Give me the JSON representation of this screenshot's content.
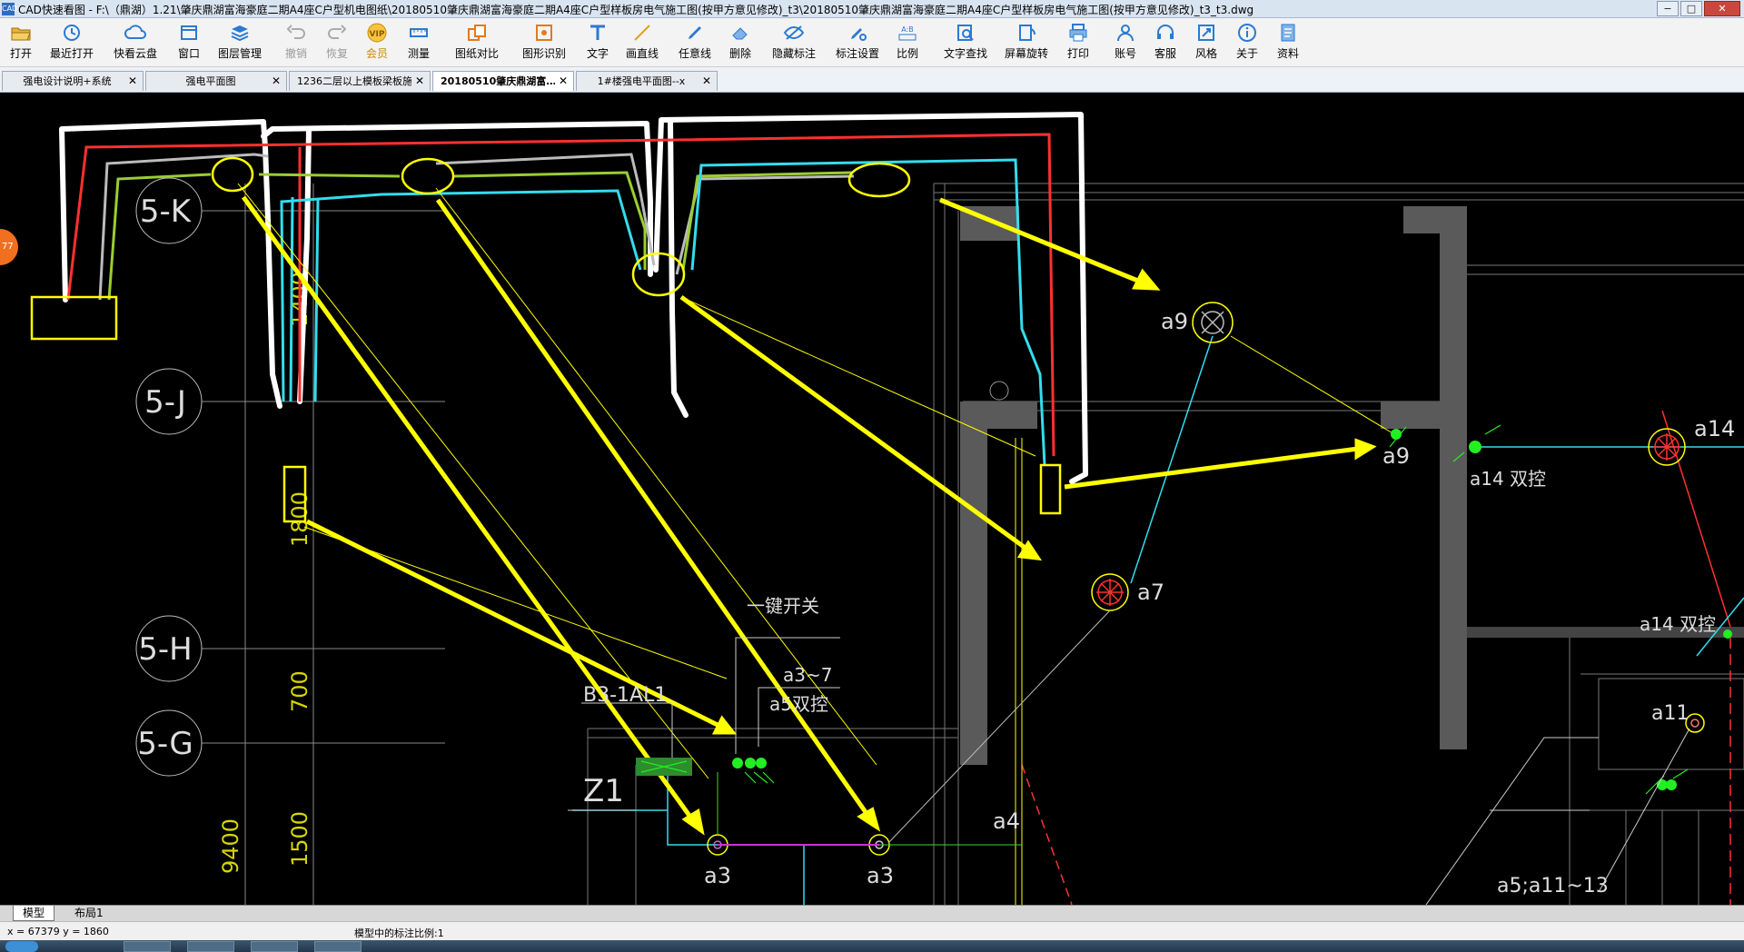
{
  "window": {
    "icon": "CAD",
    "title": "CAD快速看图 - F:\\（鼎湖）1.21\\肇庆鼎湖富海豪庭二期A4座C户型机电图纸\\20180510肇庆鼎湖富海豪庭二期A4座C户型样板房电气施工图(按甲方意见修改)_t3\\20180510肇庆鼎湖富海豪庭二期A4座C户型样板房电气施工图(按甲方意见修改)_t3_t3.dwg",
    "minimize": "−",
    "maximize": "□",
    "close": "✕"
  },
  "toolbar": [
    {
      "label": "打开",
      "icon": "open-folder-icon",
      "enabled": true
    },
    {
      "label": "最近打开",
      "icon": "recent-clock-icon",
      "enabled": true
    },
    {
      "label": "快看云盘",
      "icon": "cloud-icon",
      "enabled": true
    },
    {
      "label": "窗口",
      "icon": "window-icon",
      "enabled": true
    },
    {
      "label": "图层管理",
      "icon": "layers-icon",
      "enabled": true
    },
    {
      "label": "撤销",
      "icon": "undo-icon",
      "enabled": false
    },
    {
      "label": "恢复",
      "icon": "redo-icon",
      "enabled": false
    },
    {
      "label": "会员",
      "icon": "vip-icon",
      "enabled": true
    },
    {
      "label": "测量",
      "icon": "measure-icon",
      "enabled": true
    },
    {
      "label": "图纸对比",
      "icon": "compare-icon",
      "enabled": true
    },
    {
      "label": "图形识别",
      "icon": "recognize-icon",
      "enabled": true
    },
    {
      "label": "文字",
      "icon": "text-icon",
      "enabled": true
    },
    {
      "label": "画直线",
      "icon": "line-icon",
      "enabled": true
    },
    {
      "label": "任意线",
      "icon": "pen-icon",
      "enabled": true
    },
    {
      "label": "删除",
      "icon": "eraser-icon",
      "enabled": true
    },
    {
      "label": "隐藏标注",
      "icon": "hide-eye-icon",
      "enabled": true
    },
    {
      "label": "标注设置",
      "icon": "annotation-settings-icon",
      "enabled": true
    },
    {
      "label": "比例",
      "icon": "scale-icon",
      "enabled": true
    },
    {
      "label": "文字查找",
      "icon": "text-search-icon",
      "enabled": true
    },
    {
      "label": "屏幕旋转",
      "icon": "rotate-icon",
      "enabled": true
    },
    {
      "label": "打印",
      "icon": "printer-icon",
      "enabled": true
    },
    {
      "label": "账号",
      "icon": "user-icon",
      "enabled": true
    },
    {
      "label": "客服",
      "icon": "headset-icon",
      "enabled": true
    },
    {
      "label": "风格",
      "icon": "style-icon",
      "enabled": true
    },
    {
      "label": "关于",
      "icon": "info-icon",
      "enabled": true
    },
    {
      "label": "资料",
      "icon": "docs-icon",
      "enabled": true
    }
  ],
  "tabs": [
    {
      "label": "强电设计说明+系统",
      "active": false
    },
    {
      "label": "强电平面图",
      "active": false
    },
    {
      "label": "1236二层以上模板梁板施",
      "active": false
    },
    {
      "label": "20180510肇庆鼎湖富…",
      "active": true
    },
    {
      "label": "1#楼强电平面图--x",
      "active": false
    }
  ],
  "tab_close": "✕",
  "badge": "77",
  "drawing": {
    "axis_labels": [
      "5-K",
      "5-J",
      "5-H",
      "5-G"
    ],
    "dimensions": [
      "1400",
      "1800",
      "700",
      "1500",
      "9400"
    ],
    "annotations": [
      "a9",
      "a9",
      "a14",
      "a14 双控",
      "a14 双控",
      "a7",
      "a11",
      "a5;a11~13",
      "一键开关",
      "a3~7",
      "a5双控",
      "B3-1AL1",
      "Z1",
      "a4",
      "a3",
      "a3"
    ]
  },
  "layout_tabs": [
    {
      "label": "模型",
      "active": true
    },
    {
      "label": "布局1",
      "active": false
    }
  ],
  "status": {
    "coords": "x = 67379  y = 1860",
    "scale": "模型中的标注比例:1"
  },
  "colors": {
    "background": "#000000",
    "yellow": "#ffff00",
    "red": "#ff3030",
    "cyan": "#33ddee",
    "white": "#ffffff",
    "lime": "#9acd32",
    "gray": "#555555",
    "green": "#22ee22"
  }
}
